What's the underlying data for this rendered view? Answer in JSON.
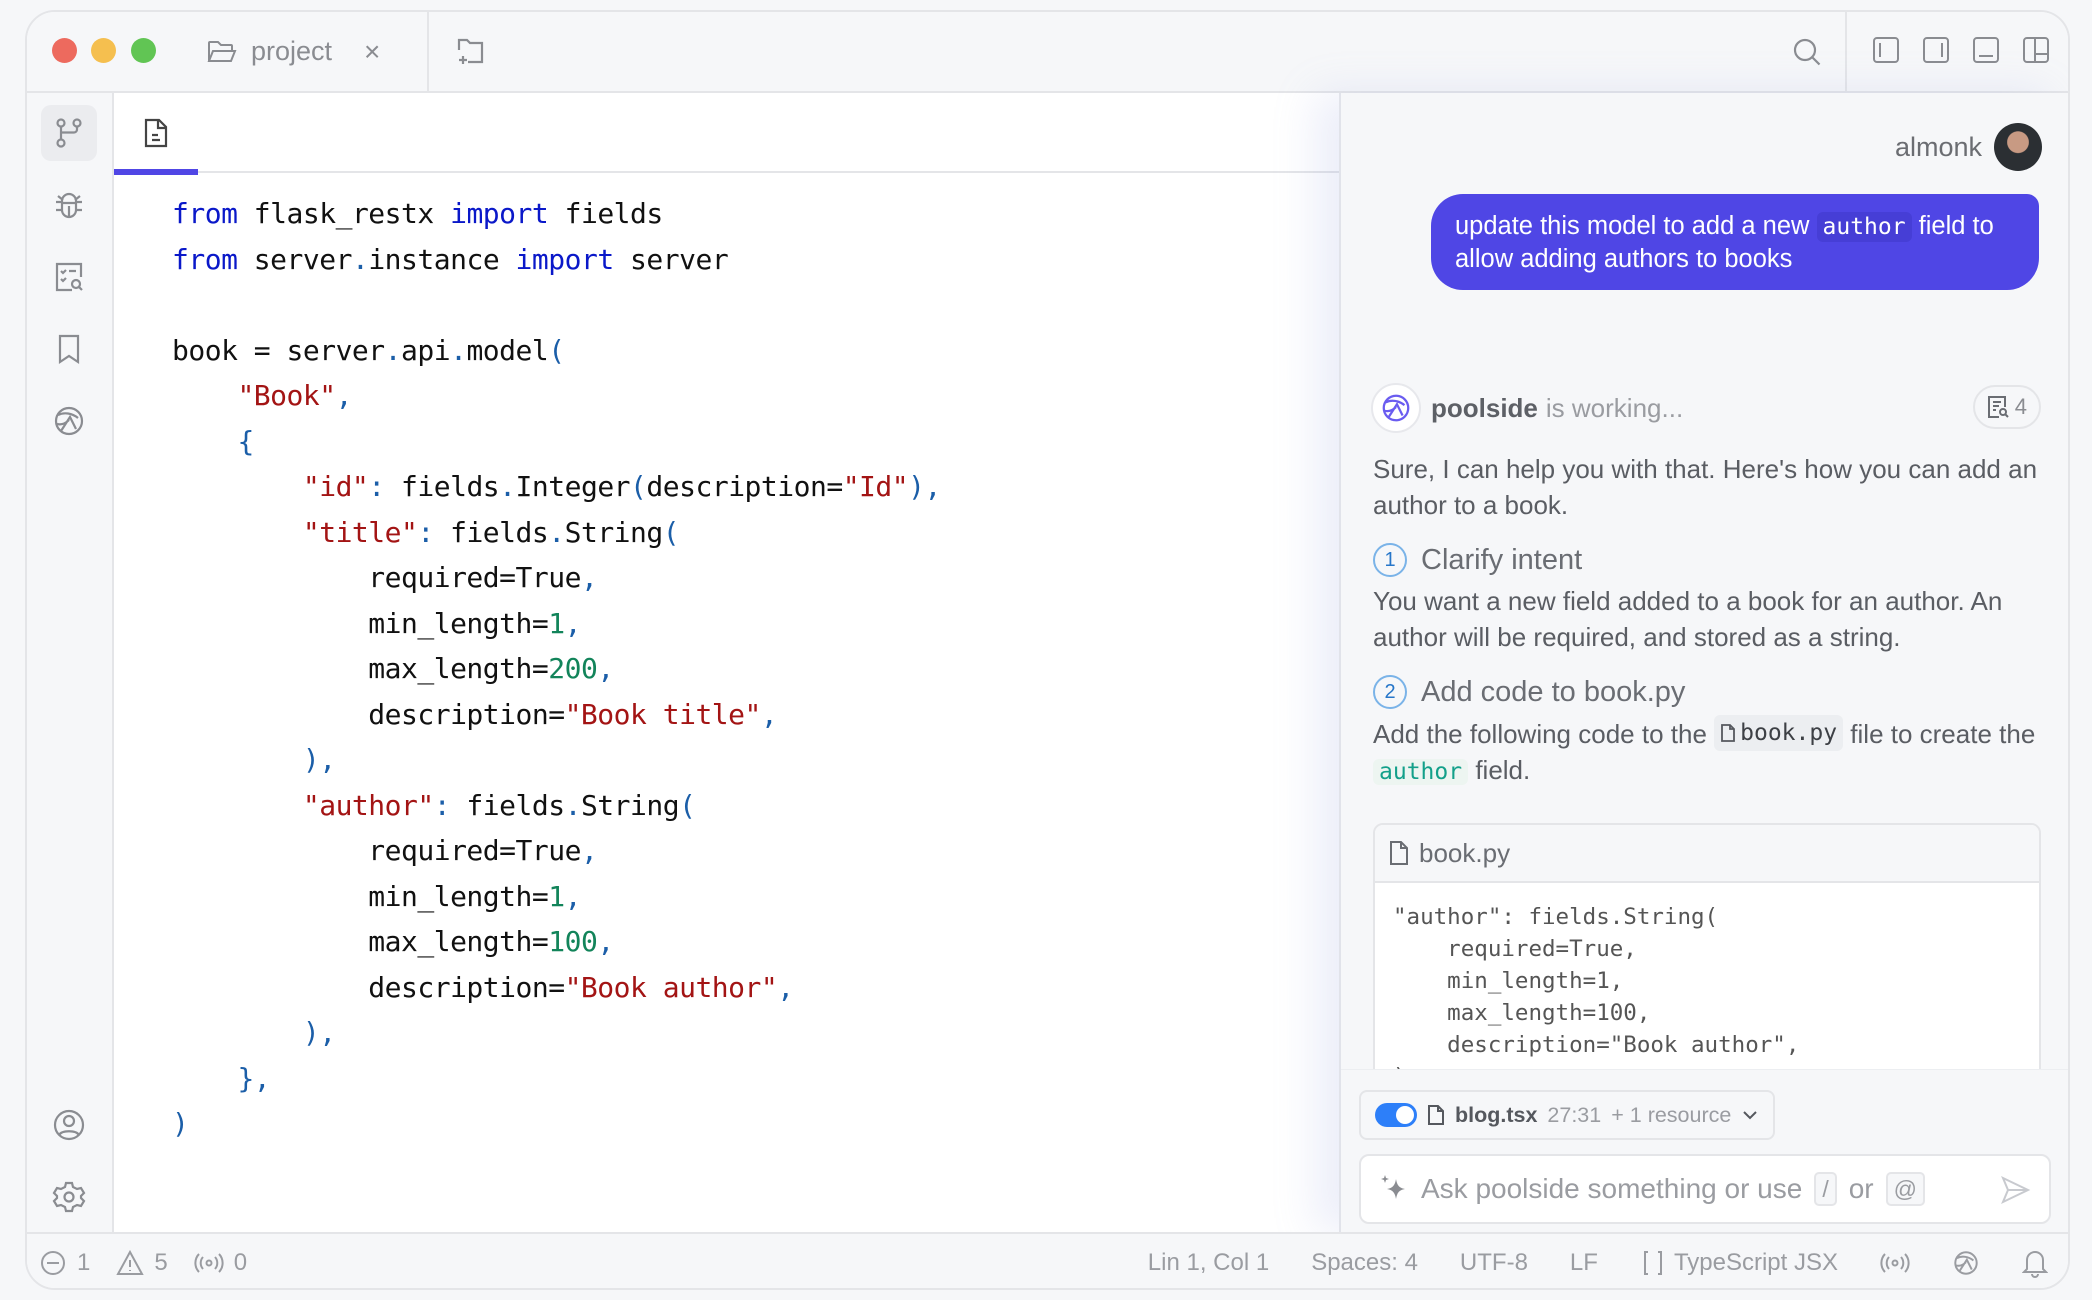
{
  "window": {
    "project_tab": "project",
    "close_glyph": "×"
  },
  "sidebar": {
    "items": [
      {
        "name": "source-control",
        "icon": "git-branch-icon",
        "active": true
      },
      {
        "name": "debug",
        "icon": "bug-icon",
        "active": false
      },
      {
        "name": "search-tasks",
        "icon": "checklist-search-icon",
        "active": false
      },
      {
        "name": "bookmarks",
        "icon": "bookmark-icon",
        "active": false
      },
      {
        "name": "poolside",
        "icon": "poolside-logo-icon",
        "active": false
      }
    ],
    "bottom_items": [
      {
        "name": "account",
        "icon": "user-circle-icon"
      },
      {
        "name": "settings",
        "icon": "gear-icon"
      }
    ]
  },
  "editor": {
    "active_tab_icon": "file-text-icon",
    "added_lines": [
      13,
      18
    ],
    "lines": [
      [
        {
          "t": "kw",
          "v": "from"
        },
        {
          "t": "",
          "v": " flask_restx "
        },
        {
          "t": "kw",
          "v": "import"
        },
        {
          "t": "",
          "v": " fields"
        }
      ],
      [
        {
          "t": "kw",
          "v": "from"
        },
        {
          "t": "",
          "v": " server"
        },
        {
          "t": "pn",
          "v": "."
        },
        {
          "t": "",
          "v": "instance "
        },
        {
          "t": "kw",
          "v": "import"
        },
        {
          "t": "",
          "v": " server"
        }
      ],
      [],
      [
        {
          "t": "",
          "v": "book = server"
        },
        {
          "t": "pn",
          "v": "."
        },
        {
          "t": "",
          "v": "api"
        },
        {
          "t": "pn",
          "v": "."
        },
        {
          "t": "",
          "v": "model"
        },
        {
          "t": "pn",
          "v": "("
        }
      ],
      [
        {
          "t": "",
          "v": "    "
        },
        {
          "t": "str",
          "v": "\"Book\""
        },
        {
          "t": "pn",
          "v": ","
        }
      ],
      [
        {
          "t": "",
          "v": "    "
        },
        {
          "t": "pn",
          "v": "{"
        }
      ],
      [
        {
          "t": "",
          "v": "        "
        },
        {
          "t": "str",
          "v": "\"id\""
        },
        {
          "t": "pn",
          "v": ":"
        },
        {
          "t": "",
          "v": " fields"
        },
        {
          "t": "pn",
          "v": "."
        },
        {
          "t": "",
          "v": "Integer"
        },
        {
          "t": "pn",
          "v": "("
        },
        {
          "t": "",
          "v": "description="
        },
        {
          "t": "str",
          "v": "\"Id\""
        },
        {
          "t": "pn",
          "v": "),"
        }
      ],
      [
        {
          "t": "",
          "v": "        "
        },
        {
          "t": "str",
          "v": "\"title\""
        },
        {
          "t": "pn",
          "v": ":"
        },
        {
          "t": "",
          "v": " fields"
        },
        {
          "t": "pn",
          "v": "."
        },
        {
          "t": "",
          "v": "String"
        },
        {
          "t": "pn",
          "v": "("
        }
      ],
      [
        {
          "t": "",
          "v": "            required=True"
        },
        {
          "t": "pn",
          "v": ","
        }
      ],
      [
        {
          "t": "",
          "v": "            min_length="
        },
        {
          "t": "num",
          "v": "1"
        },
        {
          "t": "pn",
          "v": ","
        }
      ],
      [
        {
          "t": "",
          "v": "            max_length="
        },
        {
          "t": "num",
          "v": "200"
        },
        {
          "t": "pn",
          "v": ","
        }
      ],
      [
        {
          "t": "",
          "v": "            description="
        },
        {
          "t": "str",
          "v": "\"Book title\""
        },
        {
          "t": "pn",
          "v": ","
        }
      ],
      [
        {
          "t": "",
          "v": "        "
        },
        {
          "t": "pn",
          "v": "),"
        }
      ],
      [
        {
          "t": "",
          "v": "        "
        },
        {
          "t": "str",
          "v": "\"author\""
        },
        {
          "t": "pn",
          "v": ":"
        },
        {
          "t": "",
          "v": " fields"
        },
        {
          "t": "pn",
          "v": "."
        },
        {
          "t": "",
          "v": "String"
        },
        {
          "t": "pn",
          "v": "("
        }
      ],
      [
        {
          "t": "",
          "v": "            required=True"
        },
        {
          "t": "pn",
          "v": ","
        }
      ],
      [
        {
          "t": "",
          "v": "            min_length="
        },
        {
          "t": "num",
          "v": "1"
        },
        {
          "t": "pn",
          "v": ","
        }
      ],
      [
        {
          "t": "",
          "v": "            max_length="
        },
        {
          "t": "num",
          "v": "100"
        },
        {
          "t": "pn",
          "v": ","
        }
      ],
      [
        {
          "t": "",
          "v": "            description="
        },
        {
          "t": "str",
          "v": "\"Book author\""
        },
        {
          "t": "pn",
          "v": ","
        }
      ],
      [
        {
          "t": "",
          "v": "        "
        },
        {
          "t": "pn",
          "v": "),"
        }
      ],
      [
        {
          "t": "",
          "v": "    "
        },
        {
          "t": "pn",
          "v": "},"
        }
      ],
      [
        {
          "t": "pn",
          "v": ")"
        }
      ]
    ]
  },
  "chat": {
    "user_name": "almonk",
    "user_message": {
      "before": "update this model to add a new ",
      "code": "author",
      "after": " field to allow adding authors to books"
    },
    "agent_name": "poolside",
    "agent_status": "is working...",
    "resource_count": "4",
    "intro": "Sure, I can help you with that. Here's how you can add an author to a book.",
    "steps": [
      {
        "num": "1",
        "title": "Clarify intent",
        "text": "You want a new field added to a book for an author. An author will be required, and stored as a string."
      },
      {
        "num": "2",
        "title": "Add code to book.py",
        "text_before": "Add the following code to the ",
        "file": "book.py",
        "text_mid": " file to create the ",
        "code": "author",
        "text_after": " field."
      }
    ],
    "codeblock": {
      "filename": "book.py",
      "code": "\"author\": fields.String(\n    required=True,\n    min_length=1,\n    max_length=100,\n    description=\"Book author\",\n),"
    },
    "context": {
      "enabled": true,
      "file": "blog.tsx",
      "position": "27:31",
      "extra": "+ 1 resource"
    },
    "input": {
      "placeholder": "Ask poolside something or use",
      "key1": "/",
      "or": "or",
      "key2": "@"
    }
  },
  "statusbar": {
    "errors": "1",
    "warnings": "5",
    "broadcast": "0",
    "cursor": "Lin 1, Col 1",
    "indent": "Spaces: 4",
    "encoding": "UTF-8",
    "eol": "LF",
    "language": "TypeScript JSX"
  },
  "colors": {
    "accent": "#4f46e5",
    "added_line_bg": "#ecfbf1",
    "keyword": "#0a18c9",
    "string": "#a31414",
    "number": "#12845a",
    "toggle": "#2d7ff9"
  }
}
